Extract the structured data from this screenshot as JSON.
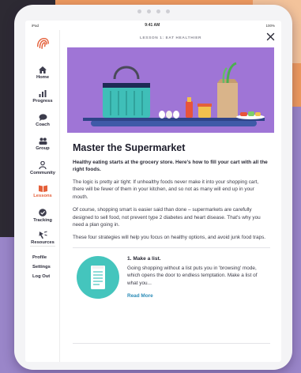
{
  "status_bar": {
    "left": "iPad",
    "time": "9:41 AM",
    "right": "100%"
  },
  "sidebar": {
    "nav": [
      {
        "label": "Home",
        "icon": "home-icon"
      },
      {
        "label": "Progress",
        "icon": "bar-chart-icon"
      },
      {
        "label": "Coach",
        "icon": "chat-icon"
      },
      {
        "label": "Group",
        "icon": "group-icon"
      },
      {
        "label": "Community",
        "icon": "community-icon"
      },
      {
        "label": "Lessons",
        "icon": "book-icon",
        "active": true
      },
      {
        "label": "Tracking",
        "icon": "check-circle-icon"
      },
      {
        "label": "Resources",
        "icon": "resources-icon"
      }
    ],
    "links": [
      "Profile",
      "Settings",
      "Log Out"
    ]
  },
  "header": {
    "lesson_label": "LESSON 1: EAT HEALTHIER"
  },
  "article": {
    "title": "Master the Supermarket",
    "subtitle": "Healthy eating starts at the grocery store. Here's how to fill your cart with all the right foods.",
    "paragraphs": [
      "The logic is pretty air tight: If unhealthy foods never make it into your shopping cart, there will be fewer of them in your kitchen, and so not as many will end up in your mouth.",
      "Of course, shopping smart is easier said than done – supermarkets are carefully designed to sell food, not prevent type 2 diabetes and heart disease. That's why you need a plan going in.",
      "These four strategies will help you focus on healthy options, and avoid junk food traps."
    ],
    "step": {
      "title": "1. Make a list.",
      "text": "Going shopping without a list puts you in 'browsing' mode, which opens the door to endless temptation. Make a list of what you...",
      "link": "Read More"
    }
  },
  "colors": {
    "accent": "#e4603a",
    "hero_bg": "#9f75d6",
    "step_icon_bg": "#44c5bd",
    "link": "#2a8bb7"
  }
}
